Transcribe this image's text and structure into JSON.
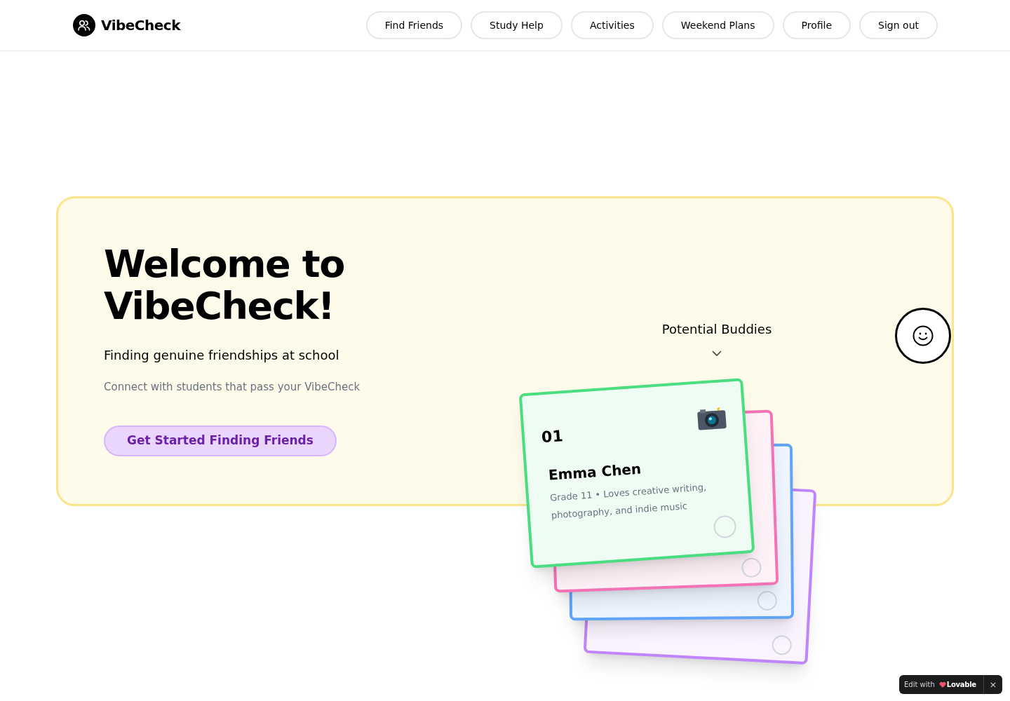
{
  "brand": {
    "name": "VibeCheck"
  },
  "nav": [
    {
      "label": "Find Friends"
    },
    {
      "label": "Study Help"
    },
    {
      "label": "Activities"
    },
    {
      "label": "Weekend Plans"
    },
    {
      "label": "Profile"
    },
    {
      "label": "Sign out"
    }
  ],
  "hero": {
    "title_lines": [
      "Welcome to",
      "VibeCheck!"
    ],
    "subtitle": "Finding genuine friendships at school",
    "tagline": "Connect with students that pass your VibeCheck",
    "cta": "Get Started Finding Friends"
  },
  "buddies": {
    "heading": "Potential Buddies",
    "cards": [
      {
        "color": "#4ade80",
        "number": "01",
        "name": "Emma Chen",
        "description": "Grade 11 • Loves creative writing, photography, and indie music"
      },
      {
        "color": "#f472b6"
      },
      {
        "color": "#60a5fa"
      },
      {
        "color": "#c084fc"
      }
    ]
  },
  "badge": {
    "prefix": "Edit with",
    "brand": "Lovable",
    "close": "×"
  }
}
